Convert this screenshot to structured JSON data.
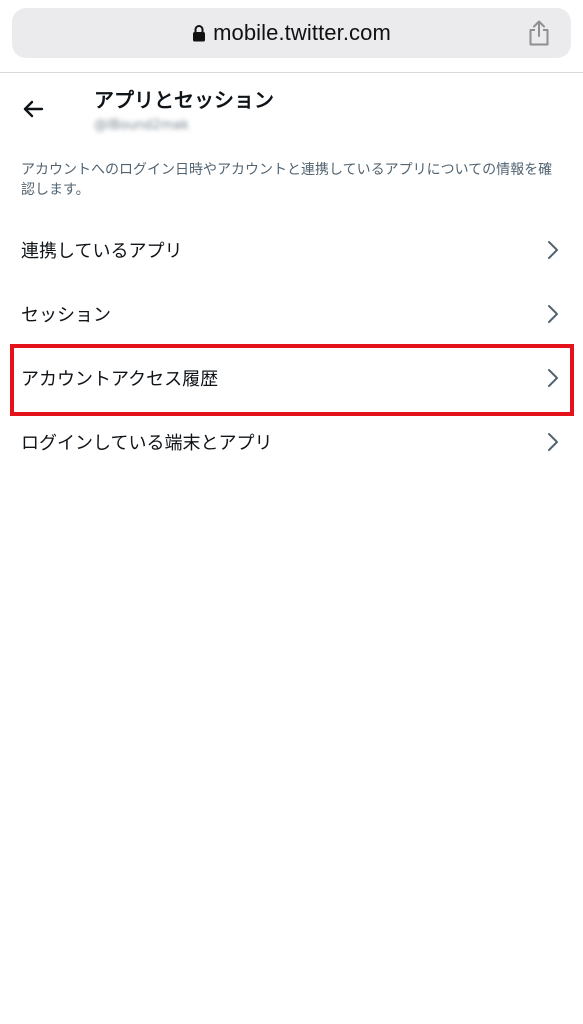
{
  "browser": {
    "url": "mobile.twitter.com",
    "lock_icon": "lock-icon",
    "share_icon": "share-icon"
  },
  "header": {
    "back_icon": "back-arrow-icon",
    "title": "アプリとセッション",
    "handle": "@IBound2mak"
  },
  "description": "アカウントへのログイン日時やアカウントと連携しているアプリについての情報を確認します。",
  "menu": {
    "items": [
      {
        "label": "連携しているアプリ",
        "icon": "chevron-right-icon"
      },
      {
        "label": "セッション",
        "icon": "chevron-right-icon"
      },
      {
        "label": "アカウントアクセス履歴",
        "icon": "chevron-right-icon"
      },
      {
        "label": "ログインしている端末とアプリ",
        "icon": "chevron-right-icon"
      }
    ]
  },
  "colors": {
    "highlight": "#e3121b",
    "text_primary": "#0f1419",
    "text_secondary": "#536471"
  }
}
